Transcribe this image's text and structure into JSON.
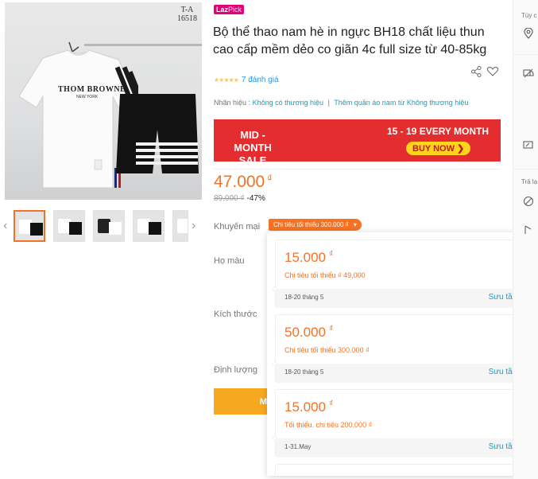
{
  "gallery": {
    "tag_line1": "T-A",
    "tag_line2": "16518",
    "shirt_brand": "THOM BROWNE",
    "shirt_sub": "NEW YORK",
    "prev_arrow": "‹",
    "next_arrow": "›"
  },
  "badge": {
    "laz": "Laz",
    "pick": "Pick"
  },
  "product": {
    "title": "Bộ thể thao nam hè in ngực BH18 chất liệu thun cao cấp mềm dẻo co giãn 4c full size từ 40-85kg",
    "rating_stars": "★★★★★",
    "rating_count": "7 đánh giá",
    "brand_label": "Nhãn hiệu :",
    "brand_value": "Không có thương hiệu",
    "brand_more": "Thêm quần áo nam từ Không thương hiệu",
    "price": "47.000",
    "currency": "₫",
    "old_price": "89.000 ₫",
    "discount": "-47%"
  },
  "banner": {
    "left_line1": "MID - MONTH",
    "left_line2": "SALE",
    "right_text": "15 - 19 EVERY MONTH",
    "button": "BUY NOW ❯"
  },
  "options": {
    "promo_label": "Khuyến mại",
    "promo_tag": "Chi tiêu tối thiểu 300.000 ₫",
    "promo_caret": "▾",
    "color_label": "Họ màu",
    "size_label": "Kích thước",
    "qty_label": "Định lượng",
    "buy_button": "M"
  },
  "vouchers": [
    {
      "amount": "15.000",
      "currency": "₫",
      "condition": "Chi tiêu tối thiểu ₫ 49,000",
      "date": "18-20 tháng 5",
      "action": "Sưu tầm"
    },
    {
      "amount": "50.000",
      "currency": "₫",
      "condition": "Chi tiêu tối thiểu 300.000 ₫",
      "date": "18-20 tháng 5",
      "action": "Sưu tầm"
    },
    {
      "amount": "15.000",
      "currency": "₫",
      "condition": "Tối thiểu. chi tiêu 200.000 ₫",
      "date": "1-31.May",
      "action": "Sưu tầm"
    }
  ],
  "sidebar": {
    "top_label": "Tùy c",
    "mid_label": "Trả lạ"
  },
  "colors": {
    "accent": "#f57224",
    "link": "#1a9cb7",
    "banner": "#e42d2e"
  }
}
